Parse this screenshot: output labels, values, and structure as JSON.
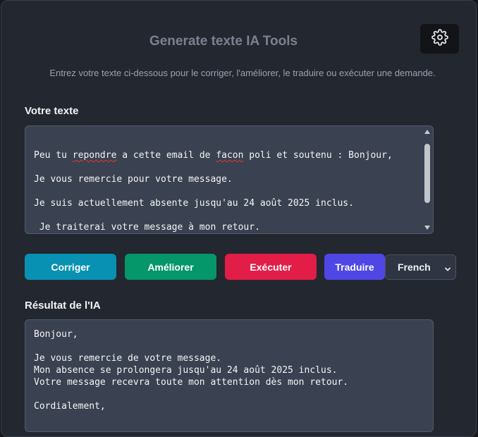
{
  "header": {
    "title": "Generate texte IA Tools",
    "subtitle": "Entrez votre texte ci-dessous pour le corriger, l'améliorer, le traduire ou exécuter une demande.",
    "settings_icon": "gear-icon"
  },
  "input": {
    "label": "Votre texte",
    "line1": {
      "a": "Peu tu ",
      "b": "repondre",
      "c": " a cette email de ",
      "d": "facon",
      "e": " poli et soutenu : Bonjour,"
    },
    "line2": "",
    "line3": "Je vous remercie pour votre message.",
    "line4": "",
    "line5": "Je suis actuellement absente jusqu'au 24 août 2025 inclus.",
    "line6": "",
    "line7": " Je traiterai votre message à mon retour."
  },
  "actions": {
    "corriger": "Corriger",
    "ameliorer": "Améliorer",
    "executer": "Exécuter",
    "traduire": "Traduire",
    "language": "French"
  },
  "output": {
    "label": "Résultat de l'IA",
    "text": "Bonjour,\n\nJe vous remercie de votre message.\nMon absence se prolongera jusqu'au 24 août 2025 inclus.\nVotre message recevra toute mon attention dès mon retour.\n\nCordialement,"
  },
  "colors": {
    "corriger": "#0891b2",
    "ameliorer": "#059669",
    "executer": "#e11d48",
    "traduire": "#4f46e5",
    "background": "#23272f"
  }
}
